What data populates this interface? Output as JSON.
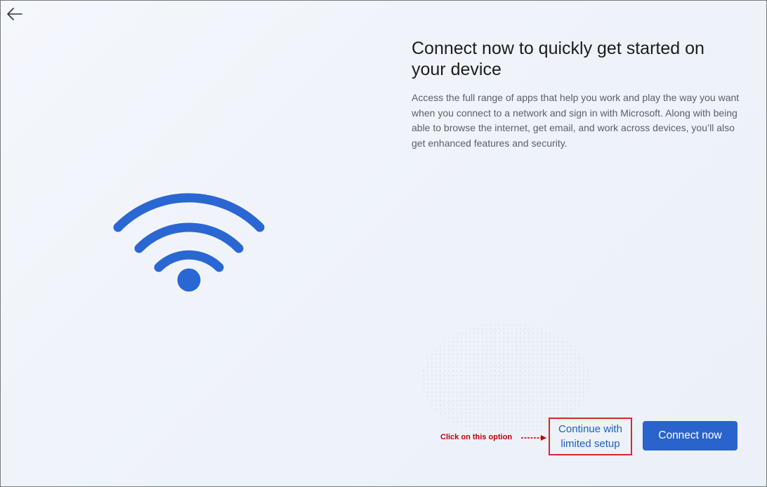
{
  "page": {
    "title": "Connect now to quickly get started on your device",
    "description": "Access the full range of apps that help you work and play the way you want when you connect to a network and sign in with Microsoft. Along with being able to browse the internet, get email, and work across devices, you’ll also get enhanced features and security."
  },
  "icons": {
    "back": "back-arrow-icon",
    "illustration": "wifi-icon",
    "annotation": "right-arrow-icon"
  },
  "annotation": {
    "note": "Click on this option"
  },
  "actions": {
    "limited_setup_label": "Continue with limited setup",
    "connect_label": "Connect now"
  },
  "colors": {
    "accent": "#2b63cc",
    "wifi": "#2a67d2",
    "annotation_red": "#c00000",
    "link_blue": "#1d5fbf"
  }
}
